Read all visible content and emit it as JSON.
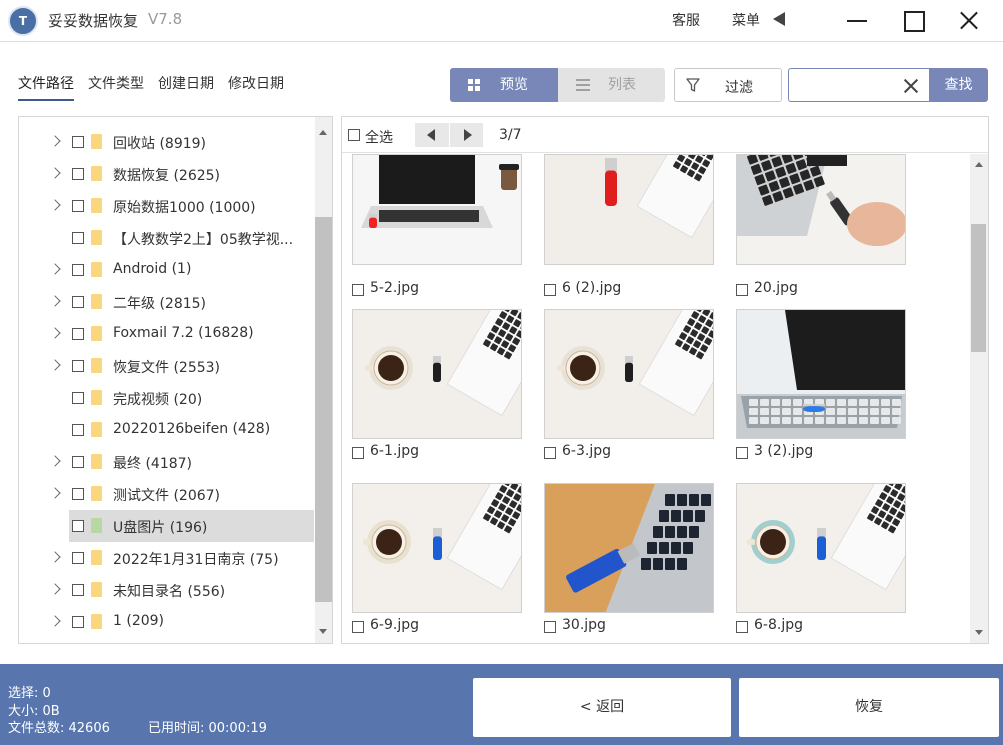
{
  "app": {
    "title": "妥妥数据恢复",
    "version": "V7.8",
    "logo_text": "T"
  },
  "titlebar": {
    "support_label": "客服",
    "menu_label": "菜单"
  },
  "filter_tabs": [
    "文件路径",
    "文件类型",
    "创建日期",
    "修改日期"
  ],
  "view_toggle": {
    "preview_label": "预览",
    "list_label": "列表",
    "active": "preview"
  },
  "filter_button_label": "过滤",
  "search": {
    "value": "",
    "placeholder": "",
    "button_label": "查找"
  },
  "tree": {
    "items": [
      {
        "label": "回收站  (8919)",
        "expandable": true
      },
      {
        "label": "数据恢复  (2625)",
        "expandable": true
      },
      {
        "label": "原始数据1000  (1000)",
        "expandable": true
      },
      {
        "label": "【人教数学2上】05教学视...",
        "expandable": false
      },
      {
        "label": "Android  (1)",
        "expandable": true
      },
      {
        "label": "二年级  (2815)",
        "expandable": true
      },
      {
        "label": "Foxmail 7.2  (16828)",
        "expandable": true
      },
      {
        "label": "恢复文件  (2553)",
        "expandable": true
      },
      {
        "label": "完成视频  (20)",
        "expandable": false
      },
      {
        "label": "20220126beifen  (428)",
        "expandable": false
      },
      {
        "label": "最终  (4187)",
        "expandable": true
      },
      {
        "label": "测试文件  (2067)",
        "expandable": true
      },
      {
        "label": "U盘图片  (196)",
        "expandable": false,
        "selected": true
      },
      {
        "label": "2022年1月31日南京  (75)",
        "expandable": true
      },
      {
        "label": "未知目录名  (556)",
        "expandable": true
      },
      {
        "label": "1  (209)",
        "expandable": true
      }
    ]
  },
  "preview": {
    "select_all_label": "全选",
    "page_label": "3/7",
    "files": [
      {
        "name": "5-2.jpg",
        "scene": "laptop-usb-coffee"
      },
      {
        "name": "6 (2).jpg",
        "scene": "red-usb-laptop-corner"
      },
      {
        "name": "20.jpg",
        "scene": "hand-usb-laptop"
      },
      {
        "name": "6-1.jpg",
        "scene": "coffee-black-usb"
      },
      {
        "name": "6-3.jpg",
        "scene": "coffee-black-usb"
      },
      {
        "name": "3 (2).jpg",
        "scene": "silver-laptop-blue-usb"
      },
      {
        "name": "6-9.jpg",
        "scene": "coffee-blue-usb"
      },
      {
        "name": "30.jpg",
        "scene": "blue-usb-wood"
      },
      {
        "name": "6-8.jpg",
        "scene": "teal-coffee-blue-usb"
      }
    ]
  },
  "status": {
    "selected": "选择: 0",
    "size": "大小: 0B",
    "total": "文件总数: 42606",
    "elapsed": "已用时间: 00:00:19"
  },
  "actions": {
    "back_label": "< 返回",
    "recover_label": "恢复"
  },
  "colors": {
    "accent": "#7887b8",
    "bottom_bar": "#5876ad",
    "folder": "#f9d77e",
    "folder_selected": "#b9d7a0"
  }
}
